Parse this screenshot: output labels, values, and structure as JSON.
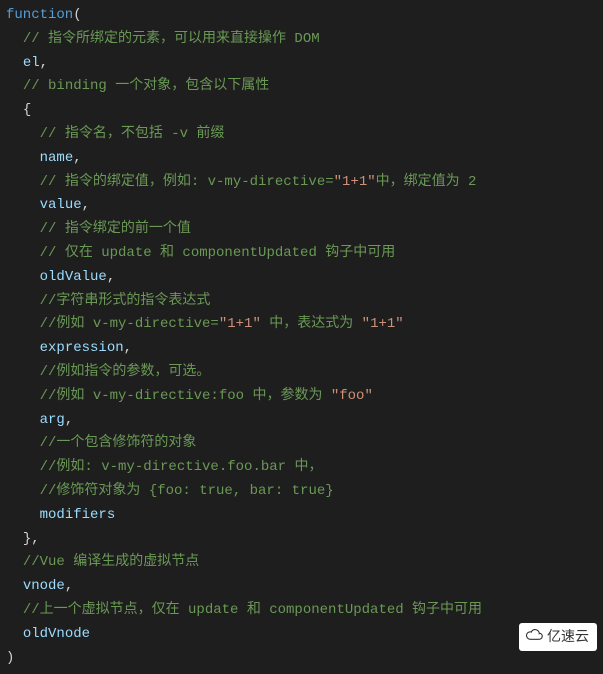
{
  "code": {
    "l1_kw": "function",
    "l1_punc": "(",
    "l2_cmt": "// 指令所绑定的元素，可以用来直接操作 DOM",
    "l3_ident": "el",
    "l3_punc": ",",
    "l4_cmt": "// binding 一个对象，包含以下属性",
    "l5_punc": "{",
    "l6_cmt": "// 指令名，不包括 -v 前缀",
    "l7_ident": "name",
    "l7_punc": ",",
    "l8_cmt1": "// 指令的绑定值，例如: v-my-directive=",
    "l8_str": "\"1+1\"",
    "l8_cmt2": "中，绑定值为 2",
    "l9_ident": "value",
    "l9_punc": ",",
    "l10_cmt": "// 指令绑定的前一个值",
    "l11_cmt": "// 仅在 update 和 componentUpdated 钩子中可用",
    "l12_ident": "oldValue",
    "l12_punc": ",",
    "l13_cmt": "//字符串形式的指令表达式",
    "l14_cmt1": "//例如 v-my-directive=",
    "l14_str1": "\"1+1\"",
    "l14_cmt2": " 中，表达式为 ",
    "l14_str2": "\"1+1\"",
    "l15_ident": "expression",
    "l15_punc": ",",
    "l16_cmt": "//例如指令的参数，可选。",
    "l17_cmt1": "//例如 v-my-directive:foo 中，参数为 ",
    "l17_str": "\"foo\"",
    "l18_ident": "arg",
    "l18_punc": ",",
    "l19_cmt": "//一个包含修饰符的对象",
    "l20_cmt": "//例如: v-my-directive.foo.bar 中，",
    "l21_cmt": "//修饰符对象为 {foo: true, bar: true}",
    "l22_ident": "modifiers",
    "l23_punc": "},",
    "l24_cmt": "//Vue 编译生成的虚拟节点",
    "l25_ident": "vnode",
    "l25_punc": ",",
    "l26_cmt": "//上一个虚拟节点，仅在 update 和 componentUpdated 钩子中可用",
    "l27_ident": "oldVnode",
    "l28_punc": ")"
  },
  "watermark": "亿速云"
}
